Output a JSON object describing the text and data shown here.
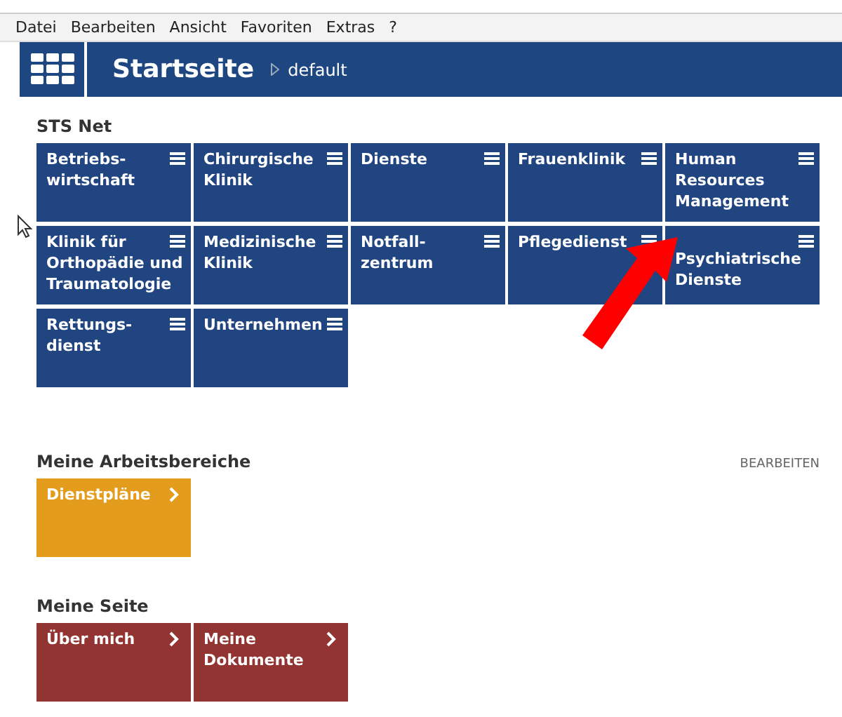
{
  "menu_bar": [
    "Datei",
    "Bearbeiten",
    "Ansicht",
    "Favoriten",
    "Extras",
    "?"
  ],
  "header": {
    "title": "Startseite",
    "breadcrumb": "default"
  },
  "sections": [
    {
      "title": "STS Net",
      "color": "#204580",
      "tiles": [
        {
          "label": "Betriebs-\nwirtschaft",
          "kind": "menu"
        },
        {
          "label": "Chirurgische Klinik",
          "kind": "menu"
        },
        {
          "label": "Dienste",
          "kind": "menu"
        },
        {
          "label": "Frauenklinik",
          "kind": "menu"
        },
        {
          "label": "Human Resources Management",
          "kind": "menu"
        },
        {
          "label": "Klinik für Orthopädie und Traumatologie",
          "kind": "menu"
        },
        {
          "label": "Medizinische Klinik",
          "kind": "menu"
        },
        {
          "label": "Notfall-\nzentrum",
          "kind": "menu"
        },
        {
          "label": "Pflegedienst",
          "kind": "menu"
        },
        {
          "label": "Psychiatrische Dienste",
          "kind": "menu"
        },
        {
          "label": "Rettungs-\ndienst",
          "kind": "menu"
        },
        {
          "label": "Unternehmen",
          "kind": "menu"
        }
      ]
    },
    {
      "title": "Meine Arbeitsbereiche",
      "action": "BEARBEITEN",
      "color": "#e49c1c",
      "tiles": [
        {
          "label": "Dienstpläne",
          "kind": "link"
        }
      ]
    },
    {
      "title": "Meine Seite",
      "color": "#923432",
      "tiles": [
        {
          "label": "Über mich",
          "kind": "link"
        },
        {
          "label": "Meine Dokumente",
          "kind": "link"
        }
      ]
    }
  ]
}
